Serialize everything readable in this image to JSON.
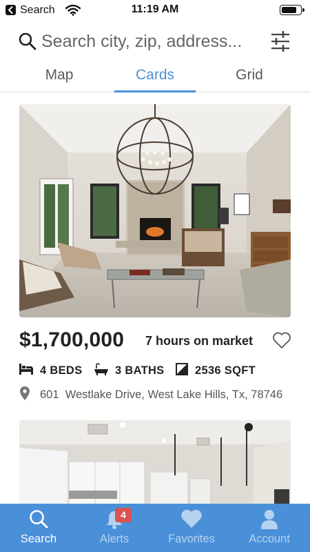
{
  "status_bar": {
    "back_app": "Search",
    "time": "11:19 AM",
    "battery_level": 0.85
  },
  "search": {
    "placeholder": "Search city, zip, address..."
  },
  "tabs": [
    {
      "label": "Map",
      "active": false
    },
    {
      "label": "Cards",
      "active": true
    },
    {
      "label": "Grid",
      "active": false
    }
  ],
  "listing": {
    "price": "$1,700,000",
    "market_time": "7 hours on market",
    "beds": "4 BEDS",
    "baths": "3 BATHS",
    "sqft": "2536 SQFT",
    "address_number": "601",
    "address": "Westlake Drive, West Lake Hills, Tx, 78746"
  },
  "bottom_nav": {
    "items": [
      {
        "label": "Search",
        "icon": "search-icon",
        "active": true
      },
      {
        "label": "Alerts",
        "icon": "bell-icon",
        "badge": "4",
        "active": false
      },
      {
        "label": "Favorites",
        "icon": "heart-icon",
        "active": false
      },
      {
        "label": "Account",
        "icon": "person-icon",
        "active": false
      }
    ]
  },
  "colors": {
    "accent": "#4a90d9",
    "badge": "#d9534f",
    "text": "#222222"
  }
}
